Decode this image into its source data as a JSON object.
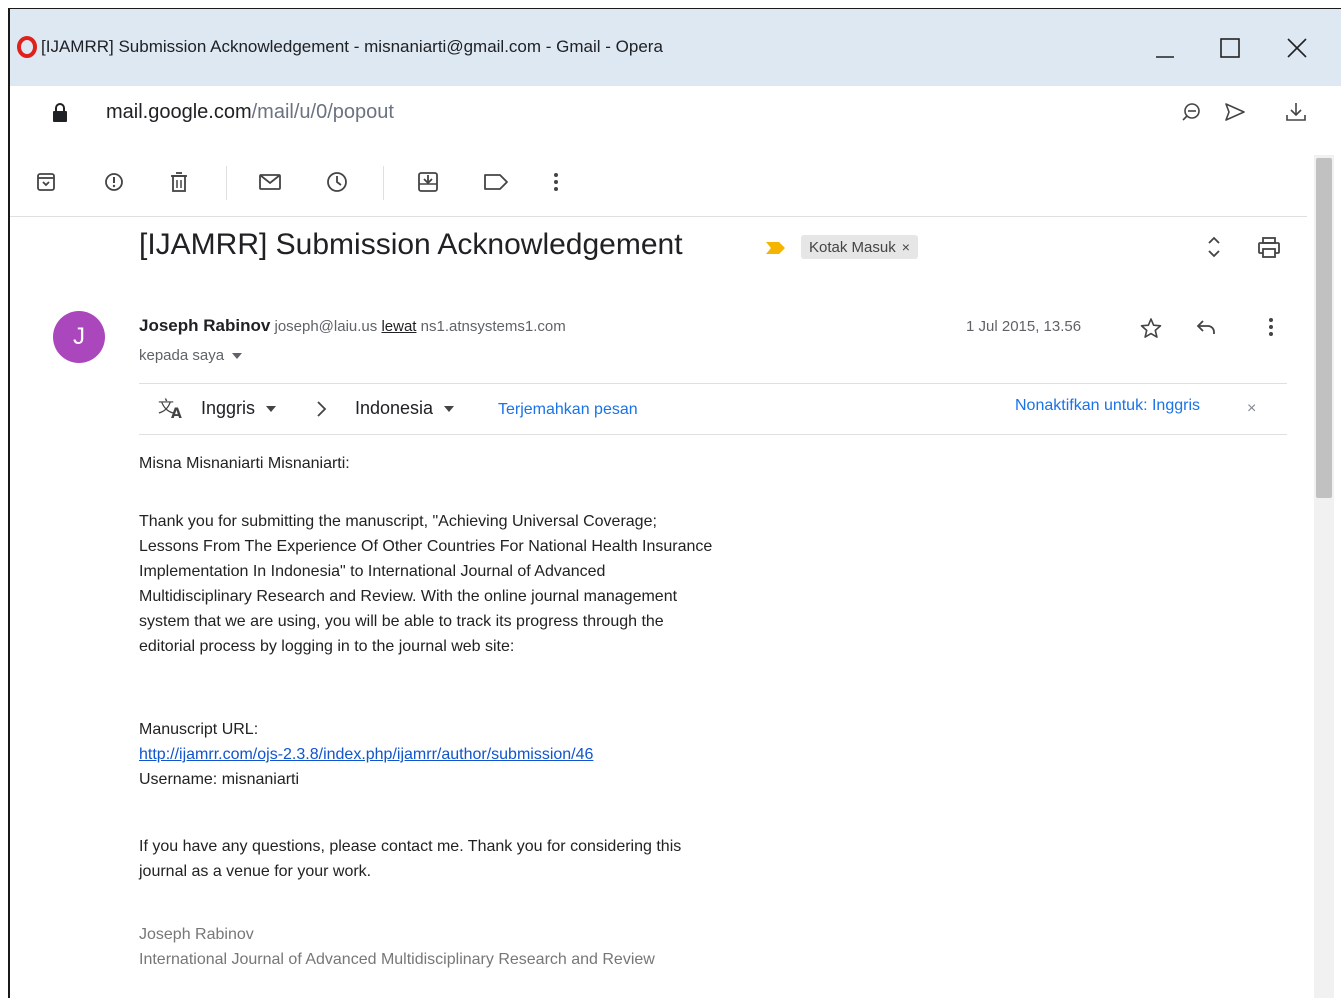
{
  "window": {
    "title": "[IJAMRR] Submission Acknowledgement - misnaniarti@gmail.com - Gmail - Opera",
    "minimize_glyph": "_",
    "maximize_glyph": "☐",
    "close_glyph": "✕"
  },
  "address": {
    "url_host": "mail.google.com",
    "url_path": "/mail/u/0/popout"
  },
  "toolbar": {
    "icons": [
      "archive-icon",
      "report-spam-icon",
      "delete-icon",
      "mark-unread-icon",
      "snooze-icon",
      "add-to-tasks-icon",
      "label-icon",
      "more-icon"
    ]
  },
  "email": {
    "subject": "[IJAMRR] Submission Acknowledgement",
    "label": "Kotak Masuk",
    "label_close": "×",
    "sender": {
      "initial": "J",
      "name": "Joseph Rabinov",
      "email": "joseph@laiu.us",
      "via_word": "lewat",
      "via_domain": "ns1.atnsystems1.com",
      "to": "kepada saya"
    },
    "date": "1 Jul 2015, 13.56",
    "translate": {
      "source_lang": "Inggris",
      "target_lang": "Indonesia",
      "translate_link": "Terjemahkan pesan",
      "turn_off": "Nonaktifkan untuk: Inggris",
      "close": "×"
    },
    "body": {
      "greeting": "Misna Misnaniarti Misnaniarti:",
      "para1_line1": "Thank you for submitting the manuscript, \"Achieving Universal Coverage;",
      "para1_line2": "Lessons From The Experience Of Other Countries For National Health Insurance",
      "para1_line3": "Implementation In Indonesia\" to International Journal of Advanced",
      "para1_line4": "Multidisciplinary Research and Review. With the online journal management",
      "para1_line5": "system that we are using, you will be able to track its progress through the",
      "para1_line6": "editorial process by logging in to the journal web site:",
      "manuscript_url_label": "Manuscript URL:",
      "manuscript_url": "http://ijamrr.com/ojs-2.3.8/index.php/ijamrr/author/submission/46",
      "username": "Username: misnaniarti",
      "para2_line1": "If you have any questions, please contact me. Thank you for considering this",
      "para2_line2": "journal as a venue for your work.",
      "sig_name": "Joseph Rabinov",
      "sig_org": "International Journal of Advanced Multidisciplinary Research and Review"
    }
  },
  "colors": {
    "titlebar": "#dee8f3",
    "avatar": "#ab47bc",
    "link": "#1a73e8",
    "important_marker": "#f4b400"
  }
}
